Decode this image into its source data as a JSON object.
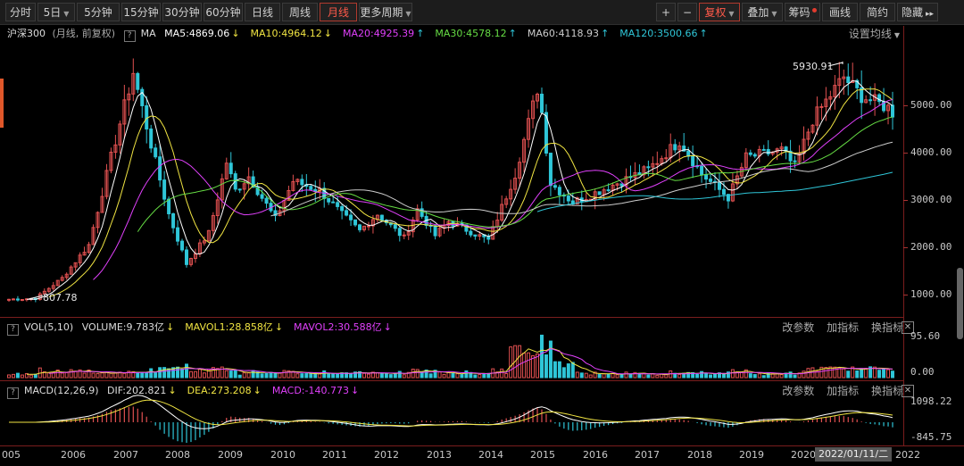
{
  "toolbar": {
    "left": [
      {
        "label": "分时",
        "dd": false
      },
      {
        "label": "5日",
        "dd": true
      },
      {
        "label": "5分钟",
        "dd": false
      },
      {
        "label": "15分钟",
        "dd": false
      },
      {
        "label": "30分钟",
        "dd": false
      },
      {
        "label": "60分钟",
        "dd": false
      },
      {
        "label": "日线",
        "dd": false
      },
      {
        "label": "周线",
        "dd": false
      },
      {
        "label": "月线",
        "dd": false,
        "active": true
      },
      {
        "label": "更多周期",
        "dd": true
      }
    ],
    "right": [
      {
        "label": "+"
      },
      {
        "label": "−"
      },
      {
        "label": "复权",
        "dd": true,
        "active": true
      },
      {
        "label": "叠加",
        "dd": true
      },
      {
        "label": "筹码",
        "dot": true
      },
      {
        "label": "画线"
      },
      {
        "label": "简约"
      },
      {
        "label": "隐藏",
        "arrow": "▸▸"
      }
    ]
  },
  "main": {
    "symbol": "沪深300",
    "period": "(月线, 前复权)",
    "ma_btn": "MA",
    "ma": [
      {
        "label": "MA5:4869.06",
        "arrow": "↓",
        "color": "#ffffff"
      },
      {
        "label": "MA10:4964.12",
        "arrow": "↓",
        "color": "#f0e442"
      },
      {
        "label": "MA20:4925.39",
        "arrow": "↑",
        "color": "#e040fb"
      },
      {
        "label": "MA30:4578.12",
        "arrow": "↑",
        "color": "#66dd44"
      },
      {
        "label": "MA60:4118.93",
        "arrow": "↑",
        "color": "#cccccc"
      },
      {
        "label": "MA120:3500.66",
        "arrow": "↑",
        "color": "#2fc6d8"
      }
    ],
    "settings": "设置均线",
    "yticks": [
      "5000.00",
      "4000.00",
      "3000.00",
      "2000.00",
      "1000.00"
    ],
    "high_label": "5930.91",
    "low_label": "807.78"
  },
  "vol": {
    "title": "VOL(5,10)",
    "items": [
      {
        "label": "VOLUME:9.783亿",
        "arrow": "↓",
        "color": "#dddddd"
      },
      {
        "label": "MAVOL1:28.858亿",
        "arrow": "↓",
        "color": "#f0e442"
      },
      {
        "label": "MAVOL2:30.588亿",
        "arrow": "↓",
        "color": "#e040fb"
      }
    ],
    "tools": [
      "改参数",
      "加指标",
      "换指标"
    ],
    "yticks": [
      "95.60",
      "0.00"
    ]
  },
  "macd": {
    "title": "MACD(12,26,9)",
    "items": [
      {
        "label": "DIF:202.821",
        "arrow": "↓",
        "color": "#dddddd"
      },
      {
        "label": "DEA:273.208",
        "arrow": "↓",
        "color": "#f0e442"
      },
      {
        "label": "MACD:-140.773",
        "arrow": "↓",
        "color": "#e040fb"
      }
    ],
    "tools": [
      "改参数",
      "加指标",
      "换指标"
    ],
    "yticks": [
      "1098.22",
      "-845.75"
    ]
  },
  "xaxis": {
    "labels": [
      "005",
      "2006",
      "2007",
      "2008",
      "2009",
      "2010",
      "2011",
      "2012",
      "2013",
      "2014",
      "2015",
      "2016",
      "2017",
      "2018",
      "2019",
      "2020",
      "2022"
    ],
    "cursor": "2022/01/11/二"
  },
  "colors": {
    "up": "#e05050",
    "down": "#2fc6d8",
    "grid": "#7a1d1d"
  },
  "chart_data": {
    "type": "candlestick",
    "interval": "monthly",
    "price_scale": [
      807.78,
      5930.91
    ],
    "anchors": [
      [
        "2005-06",
        900
      ],
      [
        "2005-12",
        920
      ],
      [
        "2006-06",
        1350
      ],
      [
        "2006-12",
        2050
      ],
      [
        "2007-05",
        3900
      ],
      [
        "2007-10",
        5700
      ],
      [
        "2008-03",
        3800
      ],
      [
        "2008-06",
        2700
      ],
      [
        "2008-10",
        1650
      ],
      [
        "2009-03",
        2300
      ],
      [
        "2009-07",
        3800
      ],
      [
        "2009-09",
        3200
      ],
      [
        "2009-12",
        3500
      ],
      [
        "2010-06",
        2600
      ],
      [
        "2010-10",
        3400
      ],
      [
        "2011-04",
        3200
      ],
      [
        "2011-09",
        2700
      ],
      [
        "2012-01",
        2350
      ],
      [
        "2012-05",
        2700
      ],
      [
        "2012-11",
        2200
      ],
      [
        "2013-02",
        2800
      ],
      [
        "2013-06",
        2250
      ],
      [
        "2013-09",
        2550
      ],
      [
        "2014-06",
        2150
      ],
      [
        "2014-12",
        3550
      ],
      [
        "2015-05",
        5350
      ],
      [
        "2015-06",
        4850
      ],
      [
        "2015-08",
        3350
      ],
      [
        "2016-01",
        2950
      ],
      [
        "2016-06",
        3150
      ],
      [
        "2017-06",
        3650
      ],
      [
        "2018-01",
        4250
      ],
      [
        "2018-06",
        3550
      ],
      [
        "2018-12",
        3050
      ],
      [
        "2019-04",
        3900
      ],
      [
        "2019-12",
        4050
      ],
      [
        "2020-03",
        3700
      ],
      [
        "2020-07",
        4700
      ],
      [
        "2021-02",
        5600
      ],
      [
        "2021-06",
        5200
      ],
      [
        "2021-12",
        4950
      ],
      [
        "2022-01",
        4850
      ]
    ],
    "volume_scale": [
      0,
      95.6
    ],
    "macd_scale": [
      -845.75,
      1098.22
    ]
  }
}
